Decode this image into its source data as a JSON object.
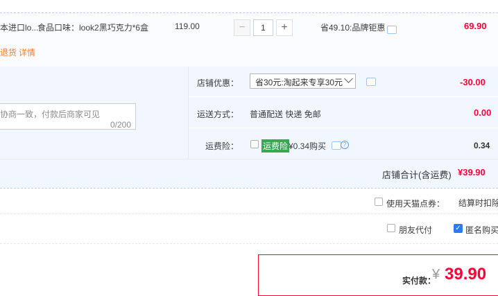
{
  "item": {
    "name": "本进口lo...",
    "sku": "食品口味：look2黑巧克力*6盒",
    "price": "119.00",
    "quantity": "1",
    "decrease_symbol": "−",
    "increase_symbol": "+",
    "promotion": "省49.10:品牌钜惠",
    "total": "69.90",
    "shipping_note": "退货",
    "details_link": "详情"
  },
  "shop": {
    "remark_placeholder": "协商一致，付款后商家可见",
    "remark_count": "0/200",
    "discount_label": "店铺优惠：",
    "discount_selected": "省30元:淘起来专享30元",
    "discount_amount": "-30.00",
    "shipping_label": "运送方式：",
    "shipping_value": "普通配送 快递 免邮",
    "shipping_amount": "0.00",
    "insurance_label": "运费险：",
    "insurance_badge": "运费险",
    "insurance_text": "¥0.34购买",
    "insurance_amount": "0.34",
    "subtotal_label": "店铺合计(含运费)",
    "subtotal_amount": "¥39.90"
  },
  "options": {
    "tmall_coupon_label": "使用天猫点券：",
    "tmall_coupon_value": "结算时扣除",
    "friend_pay_label": "朋友代付",
    "anonymous_label": "匿名购买"
  },
  "payment": {
    "label": "实付款：",
    "currency": "¥",
    "amount": "39.90"
  },
  "colors": {
    "price_red": "#ff0036",
    "link_orange": "#ff7c2a",
    "panel_blue": "#f2f7ff",
    "checkbox_blue": "#2d7bf3",
    "badge_green": "#3aa853"
  }
}
